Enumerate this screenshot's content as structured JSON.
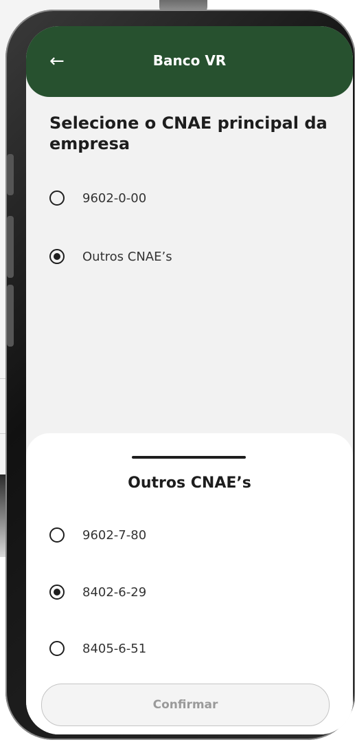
{
  "header": {
    "back_icon": "←",
    "title": "Banco VR"
  },
  "main": {
    "title": "Selecione o CNAE principal da empresa",
    "options": [
      {
        "label": "9602-0-00",
        "selected": false
      },
      {
        "label": "Outros CNAE’s",
        "selected": true
      }
    ]
  },
  "sheet": {
    "title": "Outros CNAE’s",
    "options": [
      {
        "label": "9602-7-80",
        "selected": false
      },
      {
        "label": "8402-6-29",
        "selected": true
      },
      {
        "label": "8405-6-51",
        "selected": false
      }
    ],
    "confirm_label": "Confirmar"
  },
  "colors": {
    "header_bg": "#27512f",
    "screen_bg": "#f2f2f2",
    "button_text_disabled": "#9a9a9a"
  }
}
